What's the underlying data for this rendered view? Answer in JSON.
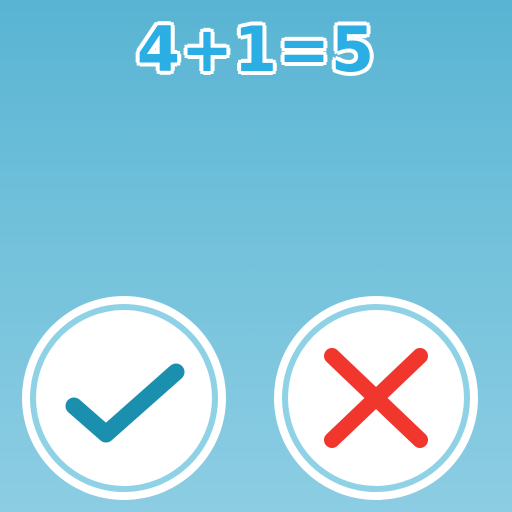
{
  "equation": {
    "text": "4+1=5"
  },
  "buttons": {
    "correct": {
      "icon": "checkmark-icon",
      "color": "#1a8fae"
    },
    "wrong": {
      "icon": "cross-icon",
      "color": "#f0362d"
    }
  },
  "colors": {
    "background_top": "#58b4d3",
    "background_bottom": "#8ccde3",
    "equation_text": "#2aaee4",
    "button_ring": "#8fd2e6"
  }
}
